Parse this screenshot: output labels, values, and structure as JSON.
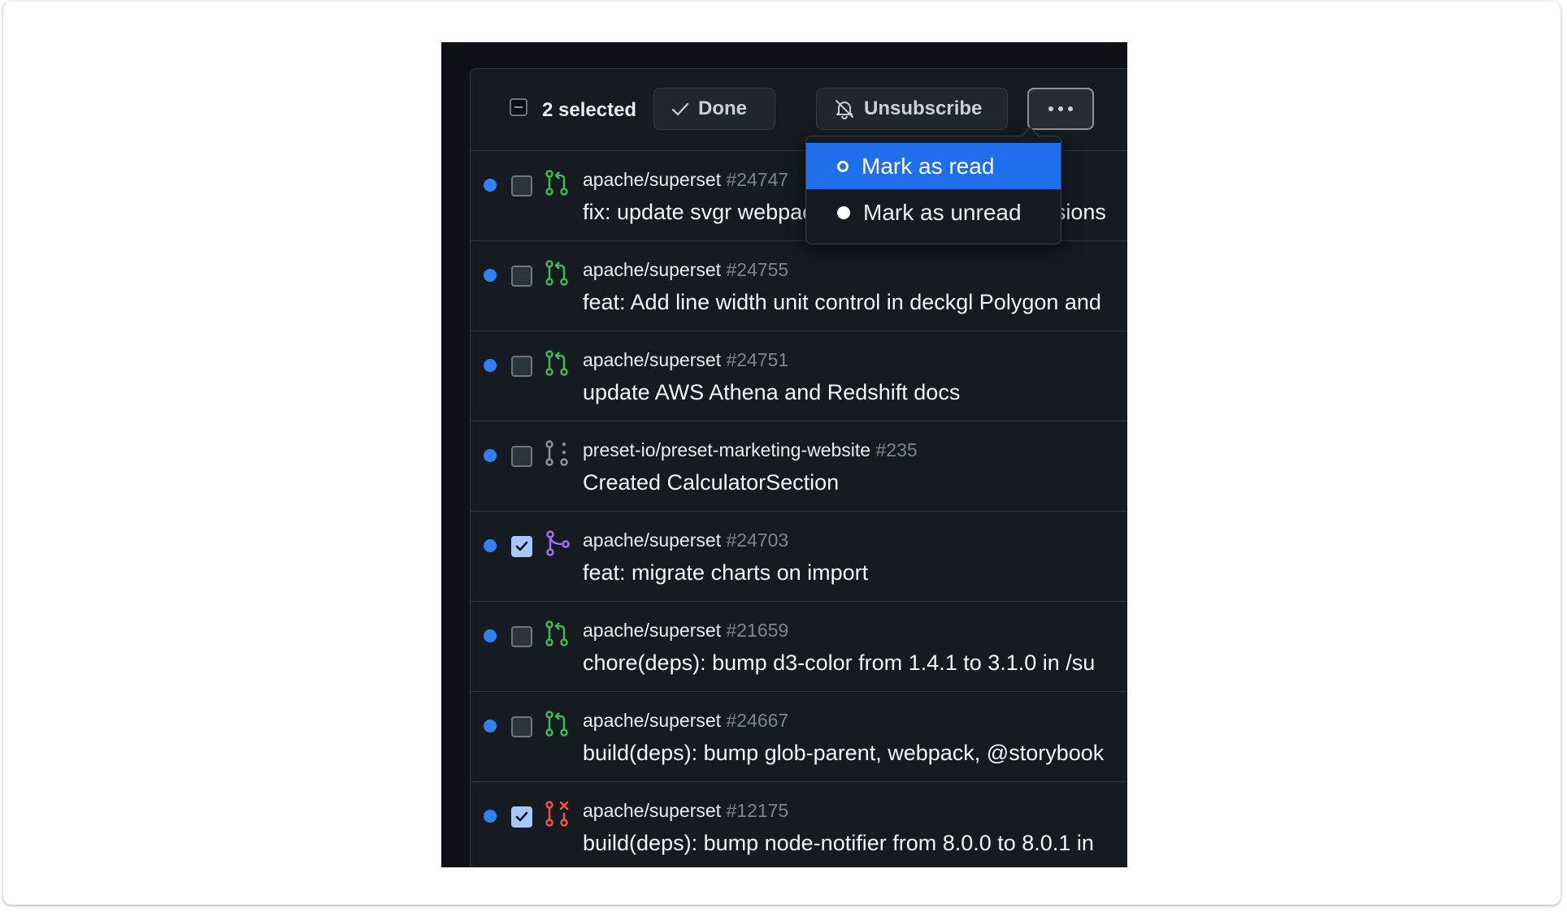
{
  "toolbar": {
    "selected_label": "2 selected",
    "done_label": "Done",
    "unsubscribe_label": "Unsubscribe"
  },
  "menu": {
    "items": [
      {
        "label": "Mark as read",
        "icon": "circle-outline-icon",
        "active": true
      },
      {
        "label": "Mark as unread",
        "icon": "circle-filled-icon",
        "active": false
      }
    ]
  },
  "notifications": [
    {
      "repo": "apache/superset",
      "number": "#24747",
      "title": "fix: update svgr webpack config to include dimensions",
      "icon": "pr-open-icon",
      "checked": false
    },
    {
      "repo": "apache/superset",
      "number": "#24755",
      "title": "feat: Add line width unit control in deckgl Polygon and",
      "icon": "pr-open-icon",
      "checked": false
    },
    {
      "repo": "apache/superset",
      "number": "#24751",
      "title": "update AWS Athena and Redshift docs",
      "icon": "pr-open-icon",
      "checked": false
    },
    {
      "repo": "preset-io/preset-marketing-website",
      "number": "#235",
      "title": "Created CalculatorSection",
      "icon": "pr-draft-icon",
      "checked": false
    },
    {
      "repo": "apache/superset",
      "number": "#24703",
      "title": "feat: migrate charts on import",
      "icon": "pr-merged-icon",
      "checked": true
    },
    {
      "repo": "apache/superset",
      "number": "#21659",
      "title": "chore(deps): bump d3-color from 1.4.1 to 3.1.0 in /su",
      "icon": "pr-open-icon",
      "checked": false
    },
    {
      "repo": "apache/superset",
      "number": "#24667",
      "title": "build(deps): bump glob-parent, webpack, @storybook",
      "icon": "pr-open-icon",
      "checked": false
    },
    {
      "repo": "apache/superset",
      "number": "#12175",
      "title": "build(deps): bump node-notifier from 8.0.0 to 8.0.1 in",
      "icon": "pr-closed-icon",
      "checked": true
    }
  ],
  "colors": {
    "unread_dot": "#2f81f7",
    "pr_open": "#3fb950",
    "pr_merged": "#a371f7",
    "pr_closed": "#f85149",
    "pr_draft": "#8b949e",
    "menu_active": "#1f6feb"
  }
}
